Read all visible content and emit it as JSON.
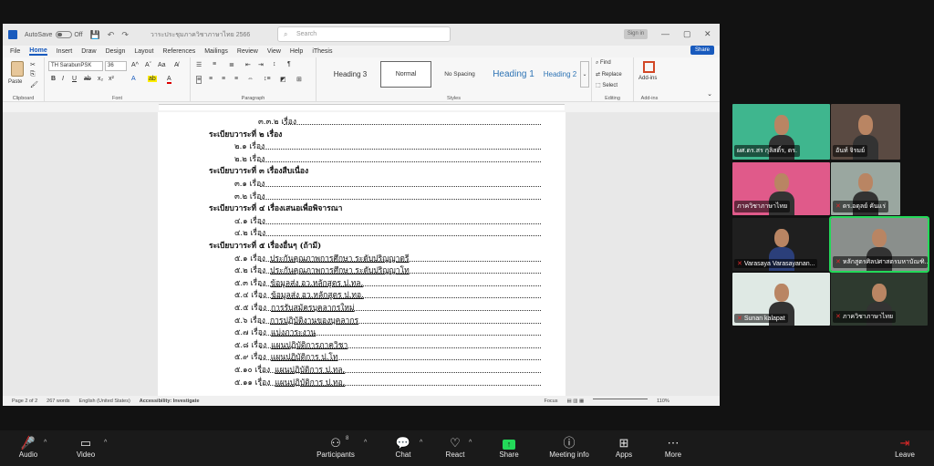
{
  "word": {
    "autosave_label": "AutoSave",
    "autosave_state": "Off",
    "doc_title": "วาระประชุมภาควิชาภาษาไทย 2566",
    "search_placeholder": "Search",
    "signin_label": "Sign in",
    "menu_tabs": [
      "File",
      "Home",
      "Insert",
      "Draw",
      "Design",
      "Layout",
      "References",
      "Mailings",
      "Review",
      "View",
      "Help",
      "iThesis"
    ],
    "active_tab": "Home",
    "share_label": "Share",
    "ribbon": {
      "paste_label": "Paste",
      "clipboard_label": "Clipboard",
      "font_name": "TH SarabunPSK",
      "font_size": "36",
      "font_label": "Font",
      "paragraph_label": "Paragraph",
      "styles": [
        "Heading 3",
        "Normal",
        "No Spacing",
        "Heading 1",
        "Heading 2"
      ],
      "styles_label": "Styles",
      "find_label": "Find",
      "replace_label": "Replace",
      "select_label": "Select",
      "editing_label": "Editing",
      "addins_label": "Add-ins",
      "addins_group_label": "Add-ins"
    },
    "document_lines": [
      {
        "text": "๓.๓.๒ เรื่อง",
        "type": "item",
        "indent": "deep",
        "underline": ""
      },
      {
        "text": "ระเบียบวาระที่ ๒ เรื่อง",
        "type": "heading"
      },
      {
        "text": "๒.๑ เรื่อง",
        "type": "item",
        "underline": ""
      },
      {
        "text": "๒.๒ เรื่อง",
        "type": "item",
        "underline": ""
      },
      {
        "text": "ระเบียบวาระที่ ๓ เรื่องสืบเนื่อง",
        "type": "heading"
      },
      {
        "text": "๓.๑ เรื่อง",
        "type": "item",
        "underline": ""
      },
      {
        "text": "๓.๒ เรื่อง",
        "type": "item",
        "underline": ""
      },
      {
        "text": "ระเบียบวาระที่ ๔ เรื่องเสนอเพื่อพิจารณา",
        "type": "heading"
      },
      {
        "text": "๔.๑ เรื่อง",
        "type": "item",
        "underline": ""
      },
      {
        "text": "๔.๒ เรื่อง",
        "type": "item",
        "underline": ""
      },
      {
        "text": "ระเบียบวาระที่ ๕ เรื่องอื่นๆ (ถ้ามี)",
        "type": "heading"
      },
      {
        "text": "๕.๑ เรื่อง",
        "type": "item",
        "underline": "ประกันคุณภาพการศึกษา ระดับปริญญาตรี"
      },
      {
        "text": "๕.๒ เรื่อง",
        "type": "item",
        "underline": "ประกันคุณภาพการศึกษา ระดับปริญญาโท"
      },
      {
        "text": "๕.๓ เรื่อง",
        "type": "item",
        "underline": "ข้อมูลส่ง อว.หลักสูตร ป.ทล."
      },
      {
        "text": "๕.๔ เรื่อง",
        "type": "item",
        "underline": "ข้อมูลส่ง อว.หลักสูตร ป.ทอ."
      },
      {
        "text": "๕.๕ เรื่อง",
        "type": "item",
        "underline": "การรับสมัครบุคลากรใหม่"
      },
      {
        "text": "๕.๖ เรื่อง",
        "type": "item",
        "underline": "การปฏิบัติงานของบุคลากร"
      },
      {
        "text": "๕.๗ เรื่อง",
        "type": "item",
        "underline": "แบ่งภาระงาน"
      },
      {
        "text": "๕.๘ เรื่อง",
        "type": "item",
        "underline": "แผนปฏิบัติการภาควิชา"
      },
      {
        "text": "๕.๙ เรื่อง",
        "type": "item",
        "underline": "แผนปฏิบัติการ ป.โท"
      },
      {
        "text": "๕.๑๐ เรื่อง",
        "type": "item",
        "underline": "แผนปฏิบัติการ ป.ทล."
      },
      {
        "text": "๕.๑๑ เรื่อง",
        "type": "item",
        "underline": "แผนปฏิบัติการ ป.ทอ."
      }
    ],
    "status": {
      "page": "Page 2 of 2",
      "words": "267 words",
      "language": "English (United States)",
      "accessibility": "Accessibility: Investigate",
      "focus": "Focus",
      "zoom": "110%"
    }
  },
  "participants": [
    {
      "name": "ผศ.ดร.สร กุลิสติ์ร, ดร.",
      "muted": false,
      "bg": "#3fb68e"
    },
    {
      "name": "อันท์ จิรมย์",
      "muted": false,
      "bg": "#5a4a42"
    },
    {
      "name": "ภาควิชาภาษาไทย",
      "muted": false,
      "bg": "#e05a8a"
    },
    {
      "name": "ดร.อดุลย์ คันแร่",
      "muted": true,
      "bg": "#9aa7a0"
    },
    {
      "name": "Varasaya Varasayanan...",
      "muted": true,
      "bg": "#1f1f1f"
    },
    {
      "name": "หลักสูตรศิลปศาสตรมหาบัณฑิ...",
      "muted": true,
      "bg": "#8a8f8c"
    },
    {
      "name": "Sunan kalapat",
      "muted": true,
      "bg": "#dfe9e4"
    },
    {
      "name": "ภาควิชาภาษาไทย",
      "muted": true,
      "bg": "#2e3a2f"
    }
  ],
  "zoom_toolbar": {
    "audio": "Audio",
    "video": "Video",
    "participants": "Participants",
    "participants_count": "8",
    "chat": "Chat",
    "react": "React",
    "share": "Share",
    "meeting_info": "Meeting info",
    "apps": "Apps",
    "more": "More",
    "leave": "Leave",
    "share_color": "#23d959",
    "leave_color": "#e02828"
  }
}
